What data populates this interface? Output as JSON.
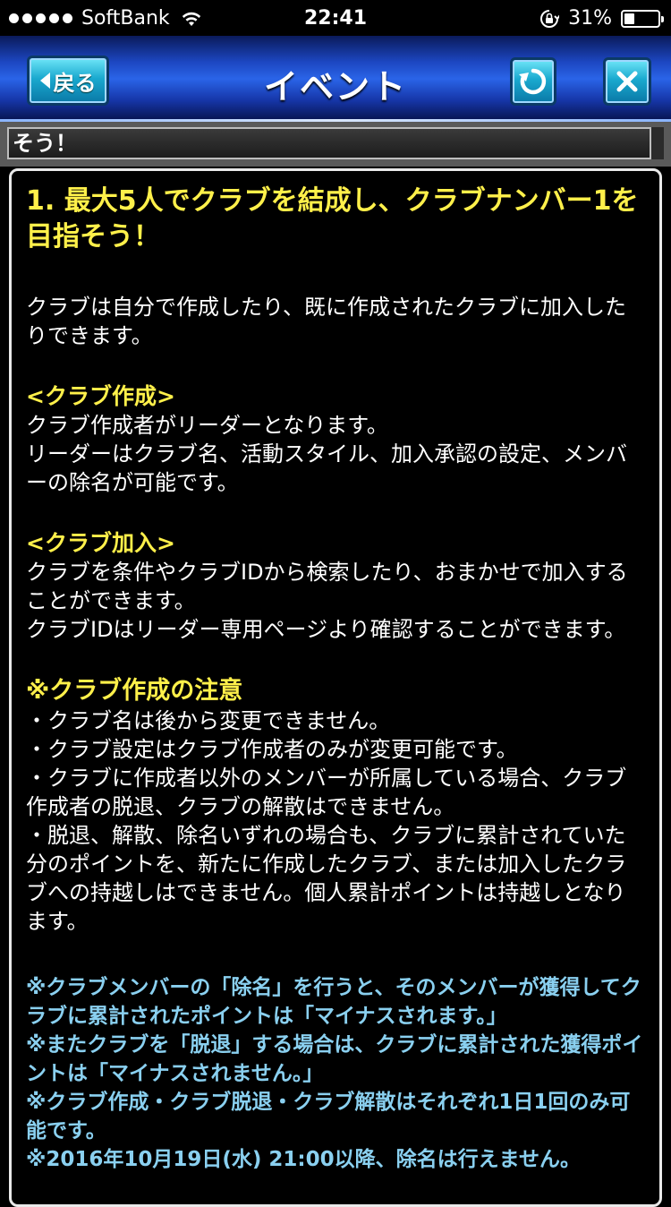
{
  "status_bar": {
    "carrier": "SoftBank",
    "time": "22:41",
    "battery": "31%",
    "battery_level": 0.31
  },
  "nav": {
    "back_label": "戻る",
    "title": "イベント"
  },
  "ticker": {
    "text": "そう！"
  },
  "content": {
    "heading": "1. 最大5人でクラブを結成し、クラブナンバー1を目指そう！",
    "intro": "クラブは自分で作成したり、既に作成されたクラブに加入したりできます。",
    "create_heading": "<クラブ作成>",
    "create_lines": [
      "クラブ作成者がリーダーとなります。",
      "リーダーはクラブ名、活動スタイル、加入承認の設定、メンバーの除名が可能です。"
    ],
    "join_heading": "<クラブ加入>",
    "join_lines": [
      "クラブを条件やクラブIDから検索したり、おまかせで加入することができます。",
      "クラブIDはリーダー専用ページより確認することができます。"
    ],
    "notes_heading": "※クラブ作成の注意",
    "notes": [
      "・クラブ名は後から変更できません。",
      "・クラブ設定はクラブ作成者のみが変更可能です。",
      "・クラブに作成者以外のメンバーが所属している場合、クラブ作成者の脱退、クラブの解散はできません。",
      "・脱退、解散、除名いずれの場合も、クラブに累計されていた分のポイントを、新たに作成したクラブ、または加入したクラブへの持越しはできません。個人累計ポイントは持越しとなります。"
    ],
    "blue_notes": [
      "※クラブメンバーの「除名」を行うと、そのメンバーが獲得してクラブに累計されたポイントは「マイナスされます。」",
      "※またクラブを「脱退」する場合は、クラブに累計された獲得ポイントは「マイナスされません。」",
      "※クラブ作成・クラブ脱退・クラブ解散はそれぞれ1日1回のみ可能です。",
      "※2016年10月19日(水) 21:00以降、除名は行えません。"
    ]
  }
}
